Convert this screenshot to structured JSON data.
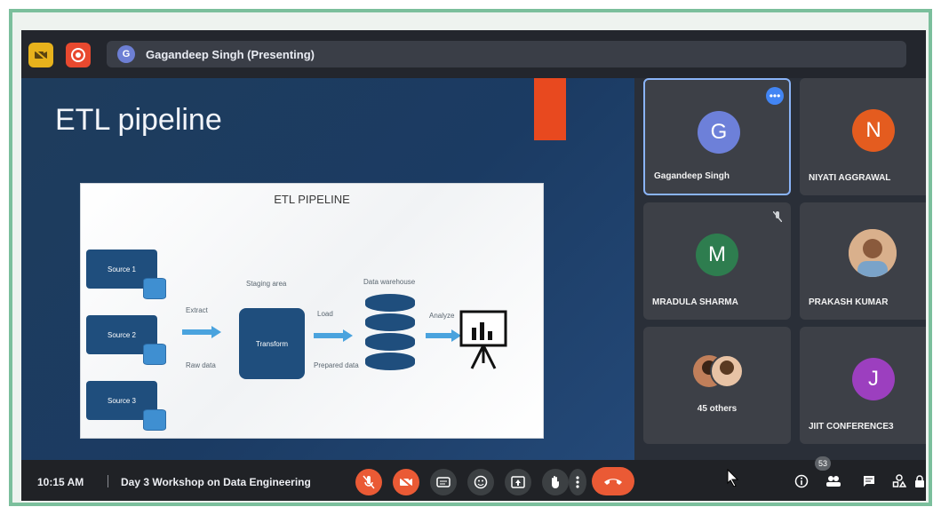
{
  "presenter": {
    "name": "Gagandeep Singh (Presenting)",
    "avatar_letter": "G"
  },
  "slide": {
    "title": "ETL pipeline",
    "diagram_title": "ETL PIPELINE",
    "sources": [
      "Source 1",
      "Source 2",
      "Source 3"
    ],
    "extract_label": "Extract",
    "raw_data_label": "Raw data",
    "staging_label": "Staging area",
    "transform_label": "Transform",
    "load_label": "Load",
    "prepared_label": "Prepared data",
    "warehouse_label": "Data warehouse",
    "analyze_label": "Analyze"
  },
  "participants": [
    {
      "letter": "G",
      "name": "Gagandeep Singh",
      "color": "#6d80d9",
      "active": true
    },
    {
      "letter": "N",
      "name": "NIYATI AGGRAWAL",
      "color": "#e45c1f"
    },
    {
      "letter": "M",
      "name": "MRADULA SHARMA",
      "color": "#2e7d4f"
    },
    {
      "letter": "",
      "name": "PRAKASH KUMAR",
      "color": "#c98f6a"
    },
    {
      "letter": "",
      "name": "45 others",
      "color": "#6a6d73"
    },
    {
      "letter": "J",
      "name": "JIIT CONFERENCE3",
      "color": "#9c3fbf"
    }
  ],
  "bottom": {
    "time": "10:15 AM",
    "meeting_title": "Day 3 Workshop on Data Engineering",
    "participant_count": "53"
  },
  "colors": {
    "accent_red": "#ea5a35",
    "active_border": "#8ab4f8",
    "frame_green": "#7bbf9c"
  }
}
